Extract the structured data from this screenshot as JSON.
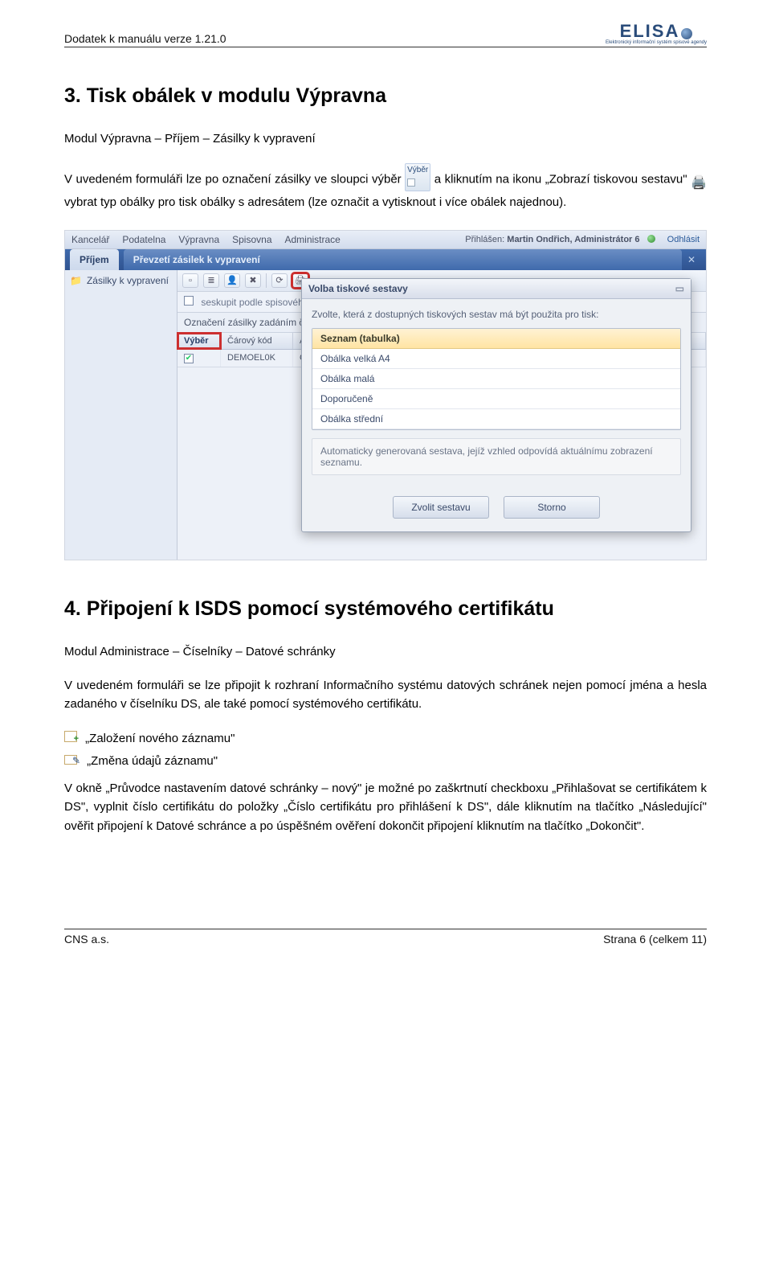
{
  "doc": {
    "header_left": "Dodatek k manuálu verze 1.21.0",
    "logo_main": "ELISA",
    "logo_sub": "Elektronický informační systém spisové agendy"
  },
  "sec3": {
    "title": "3.   Tisk obálek v modulu Výpravna",
    "subheading": "Modul Výpravna – Příjem – Zásilky k vypravení",
    "p1a": "V uvedeném formuláři lze po označení zásilky ve sloupci výběr ",
    "p1b": " a kliknutím na ikonu „Zobrazí tiskovou sestavu\" ",
    "p1c": " vybrat typ obálky pro tisk obálky s adresátem (lze označit a vytisknout i více obálek najednou).",
    "vyber_chip": "Výběr"
  },
  "app": {
    "menu": [
      "Kancelář",
      "Podatelna",
      "Výpravna",
      "Spisovna",
      "Administrace"
    ],
    "login_prefix": "Přihlášen:",
    "login_user": "Martin Ondřich, Administrátor 6",
    "logout": "Odhlásit",
    "tab_active": "Příjem",
    "panel_title": "Převzetí zásilek k vypravení",
    "side_item": "Zásilky k vypravení",
    "group_chk": "seskupit podle spisového uzlu",
    "barcode_label": "Označení zásilky zadáním čárového kódu",
    "cols": {
      "vyber": "Výběr",
      "kod": "Čárový kód",
      "adre": "Adre"
    },
    "row1_kod": "DEMOEL0K",
    "row1_adre": "CNS"
  },
  "modal": {
    "title": "Volba tiskové sestavy",
    "hint": "Zvolte, která z dostupných tiskových sestav má být použita pro tisk:",
    "items": [
      "Seznam (tabulka)",
      "Obálka velká A4",
      "Obálka malá",
      "Doporučeně",
      "Obálka střední"
    ],
    "desc": "Automaticky generovaná sestava, jejíž vzhled odpovídá aktuálnímu zobrazení seznamu.",
    "btn_ok": "Zvolit sestavu",
    "btn_cancel": "Storno"
  },
  "sec4": {
    "title": "4.   Připojení k ISDS pomocí systémového certifikátu",
    "subheading": "Modul Administrace – Číselníky – Datové schránky",
    "p1": "V uvedeném formuláři se lze připojit k rozhraní Informačního systému datových schránek nejen pomocí jména a hesla zadaného v číselníku DS, ale také pomocí systémového certifikátu.",
    "new_label": "„Založení nového záznamu\"",
    "edit_label": "„Změna údajů záznamu\"",
    "p2": "V okně „Průvodce nastavením datové schránky – nový\" je možné po zaškrtnutí checkboxu „Přihlašovat se certifikátem k DS\", vyplnit číslo certifikátu do položky „Číslo certifikátu pro přihlášení k DS\", dále kliknutím na tlačítko „Následující\" ověřit připojení k Datové schránce a po úspěšném ověření dokončit připojení kliknutím na tlačítko „Dokončit\"."
  },
  "footer": {
    "left": "CNS a.s.",
    "right": "Strana 6 (celkem 11)"
  }
}
